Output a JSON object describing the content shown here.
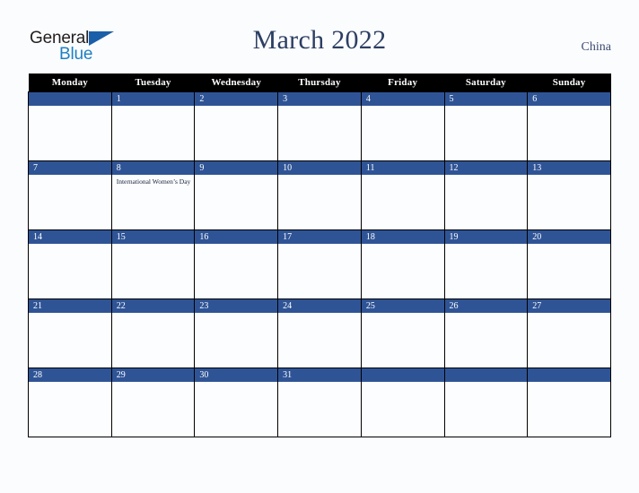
{
  "brand": {
    "name_part1": "General",
    "name_part2": "Blue",
    "triangle_color": "#1b5fa8"
  },
  "header": {
    "title": "March 2022",
    "country": "China",
    "title_color": "#2c3e63"
  },
  "calendar": {
    "weekday_headers": [
      "Monday",
      "Tuesday",
      "Wednesday",
      "Thursday",
      "Friday",
      "Saturday",
      "Sunday"
    ],
    "header_bg": "#000000",
    "daynum_bg": "#2f5496",
    "cell_bg": "#fcfdfe",
    "weeks": [
      [
        {
          "day": "",
          "events": []
        },
        {
          "day": "1",
          "events": []
        },
        {
          "day": "2",
          "events": []
        },
        {
          "day": "3",
          "events": []
        },
        {
          "day": "4",
          "events": []
        },
        {
          "day": "5",
          "events": []
        },
        {
          "day": "6",
          "events": []
        }
      ],
      [
        {
          "day": "7",
          "events": []
        },
        {
          "day": "8",
          "events": [
            "International Women’s Day"
          ]
        },
        {
          "day": "9",
          "events": []
        },
        {
          "day": "10",
          "events": []
        },
        {
          "day": "11",
          "events": []
        },
        {
          "day": "12",
          "events": []
        },
        {
          "day": "13",
          "events": []
        }
      ],
      [
        {
          "day": "14",
          "events": []
        },
        {
          "day": "15",
          "events": []
        },
        {
          "day": "16",
          "events": []
        },
        {
          "day": "17",
          "events": []
        },
        {
          "day": "18",
          "events": []
        },
        {
          "day": "19",
          "events": []
        },
        {
          "day": "20",
          "events": []
        }
      ],
      [
        {
          "day": "21",
          "events": []
        },
        {
          "day": "22",
          "events": []
        },
        {
          "day": "23",
          "events": []
        },
        {
          "day": "24",
          "events": []
        },
        {
          "day": "25",
          "events": []
        },
        {
          "day": "26",
          "events": []
        },
        {
          "day": "27",
          "events": []
        }
      ],
      [
        {
          "day": "28",
          "events": []
        },
        {
          "day": "29",
          "events": []
        },
        {
          "day": "30",
          "events": []
        },
        {
          "day": "31",
          "events": []
        },
        {
          "day": "",
          "events": []
        },
        {
          "day": "",
          "events": []
        },
        {
          "day": "",
          "events": []
        }
      ]
    ]
  }
}
